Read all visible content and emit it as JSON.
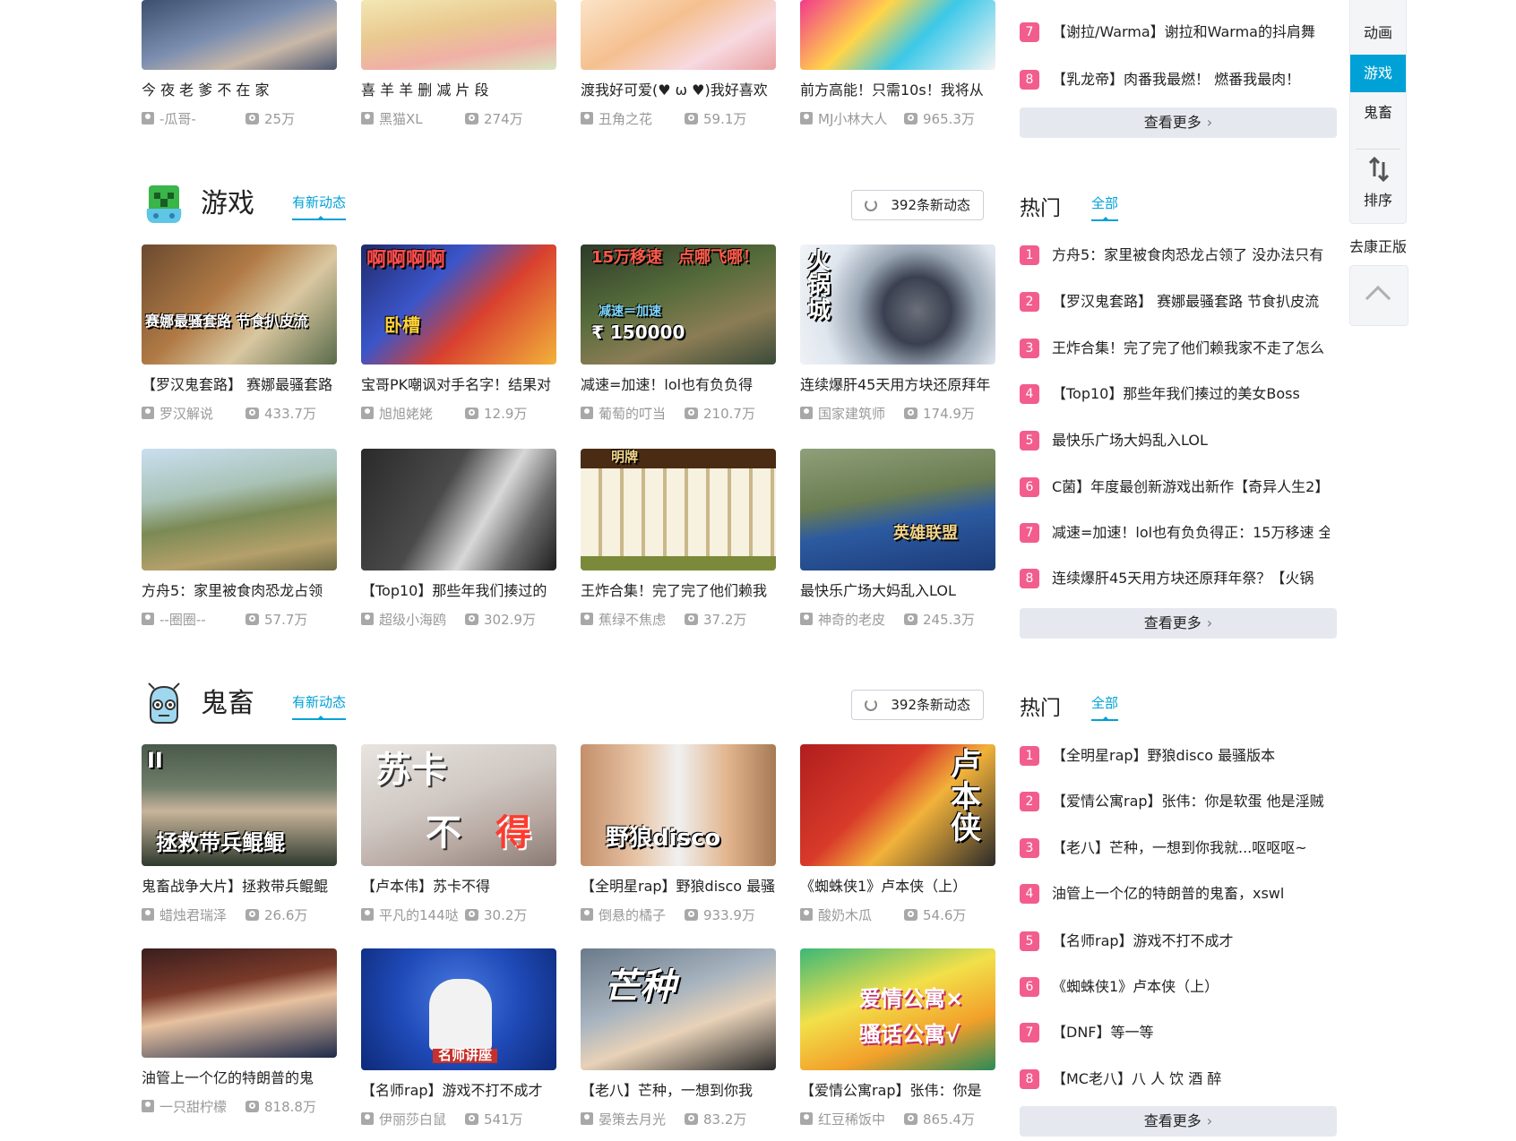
{
  "top_row": [
    {
      "title": "今 夜 老 爹 不 在 家",
      "up": "-瓜哥-",
      "plays": "25万"
    },
    {
      "title": "喜 羊 羊 删 减 片 段",
      "up": "黑猫XL",
      "plays": "274万"
    },
    {
      "title": "渡我好可爱(♥ ω ♥)我好喜欢",
      "up": "丑角之花",
      "plays": "59.1万"
    },
    {
      "title": "前方高能！只需10s！我将从",
      "up": "MJ小林大人",
      "plays": "965.3万"
    }
  ],
  "top_rank": {
    "items": [
      {
        "num": "7",
        "text": "【谢拉/Warma】谢拉和Warma的抖肩舞"
      },
      {
        "num": "8",
        "text": "【乳龙帝】肉番我最燃！ 燃番我最肉！"
      }
    ],
    "more": "查看更多"
  },
  "right_nav": {
    "items": [
      "动画",
      "游戏",
      "鬼畜"
    ],
    "sort": "排序",
    "kang": "去康正版"
  },
  "sections": [
    {
      "title": "游戏",
      "dyn": "有新动态",
      "refresh": "392条新动态",
      "thumb_text": [
        "赛娜最骚套路 节食扒皮流",
        "啊啊啊啊",
        "15万移速　点哪飞哪！",
        "火锅城",
        "英雄联盟",
        "明牌",
        "卧槽",
        "减速＝加速",
        "₹ 150000"
      ],
      "videos": [
        {
          "title": "【罗汉鬼套路】 赛娜最骚套路",
          "up": "罗汉解说",
          "plays": "433.7万"
        },
        {
          "title": "宝哥PK嘲讽对手名字！结果对",
          "up": "旭旭姥姥",
          "plays": "12.9万"
        },
        {
          "title": "减速=加速！lol也有负负得",
          "up": "葡萄的叮当",
          "plays": "210.7万"
        },
        {
          "title": "连续爆肝45天用方块还原拜年",
          "up": "国家建筑师",
          "plays": "174.9万"
        },
        {
          "title": "方舟5：家里被食肉恐龙占领",
          "up": "--圈圈--",
          "plays": "57.7万"
        },
        {
          "title": "【Top10】那些年我们揍过的",
          "up": "超级小海鸥",
          "plays": "302.9万"
        },
        {
          "title": "王炸合集！完了完了他们赖我",
          "up": "蕉绿不焦虑",
          "plays": "37.2万"
        },
        {
          "title": "最快乐广场大妈乱入LOL",
          "up": "神奇的老皮",
          "plays": "245.3万"
        }
      ],
      "rank_head": "热门",
      "rank_all": "全部",
      "rank": [
        {
          "num": "1",
          "text": "方舟5：家里被食肉恐龙占领了 没办法只有"
        },
        {
          "num": "2",
          "text": "【罗汉鬼套路】 赛娜最骚套路 节食扒皮流"
        },
        {
          "num": "3",
          "text": "王炸合集！完了完了他们赖我家不走了怎么"
        },
        {
          "num": "4",
          "text": "【Top10】那些年我们揍过的美女Boss"
        },
        {
          "num": "5",
          "text": "最快乐广场大妈乱入LOL"
        },
        {
          "num": "6",
          "text": "C菌】年度最创新游戏出新作【奇异人生2】"
        },
        {
          "num": "7",
          "text": "减速=加速！lol也有负负得正：15万移速 全"
        },
        {
          "num": "8",
          "text": "连续爆肝45天用方块还原拜年祭？【火锅"
        }
      ],
      "more": "查看更多"
    },
    {
      "title": "鬼畜",
      "dyn": "有新动态",
      "refresh": "392条新动态",
      "thumb_text": [
        "拯救带兵鲲鲲",
        "苏卡",
        "不",
        "得",
        "野狼disco",
        "卢本侠",
        "名师讲座",
        "芒种",
        "爱情公寓×",
        "骚话公寓√",
        "II"
      ],
      "videos": [
        {
          "title": "鬼畜战争大片】拯救带兵鲲鲲",
          "up": "蜡烛君瑞泽",
          "plays": "26.6万"
        },
        {
          "title": "【卢本伟】苏卡不得",
          "up": "平凡的144哒",
          "plays": "30.2万"
        },
        {
          "title": "【全明星rap】野狼disco 最骚",
          "up": "倒悬的橘子",
          "plays": "933.9万"
        },
        {
          "title": "《蜘蛛侠1》卢本侠（上）",
          "up": "酸奶木瓜",
          "plays": "54.6万"
        },
        {
          "title": "油管上一个亿的特朗普的鬼",
          "up": "一只甜柠檬",
          "plays": "818.8万"
        },
        {
          "title": "【名师rap】游戏不打不成才",
          "up": "伊丽莎白鼠",
          "plays": "541万"
        },
        {
          "title": "【老八】芒种，一想到你我",
          "up": "晏策去月光",
          "plays": "83.2万"
        },
        {
          "title": "【爱情公寓rap】张伟：你是",
          "up": "红豆稀饭中",
          "plays": "865.4万"
        }
      ],
      "rank_head": "热门",
      "rank_all": "全部",
      "rank": [
        {
          "num": "1",
          "text": "【全明星rap】野狼disco 最骚版本"
        },
        {
          "num": "2",
          "text": "【爱情公寓rap】张伟：你是软蛋 他是淫贼"
        },
        {
          "num": "3",
          "text": "【老八】芒种，一想到你我就...呕呕呕~"
        },
        {
          "num": "4",
          "text": "油管上一个亿的特朗普的鬼畜，xswl"
        },
        {
          "num": "5",
          "text": "【名师rap】游戏不打不成才"
        },
        {
          "num": "6",
          "text": "《蜘蛛侠1》卢本侠（上）"
        },
        {
          "num": "7",
          "text": "【DNF】等一等"
        },
        {
          "num": "8",
          "text": "【MC老八】八 人 饮 酒 醉"
        }
      ],
      "more": "查看更多"
    }
  ]
}
